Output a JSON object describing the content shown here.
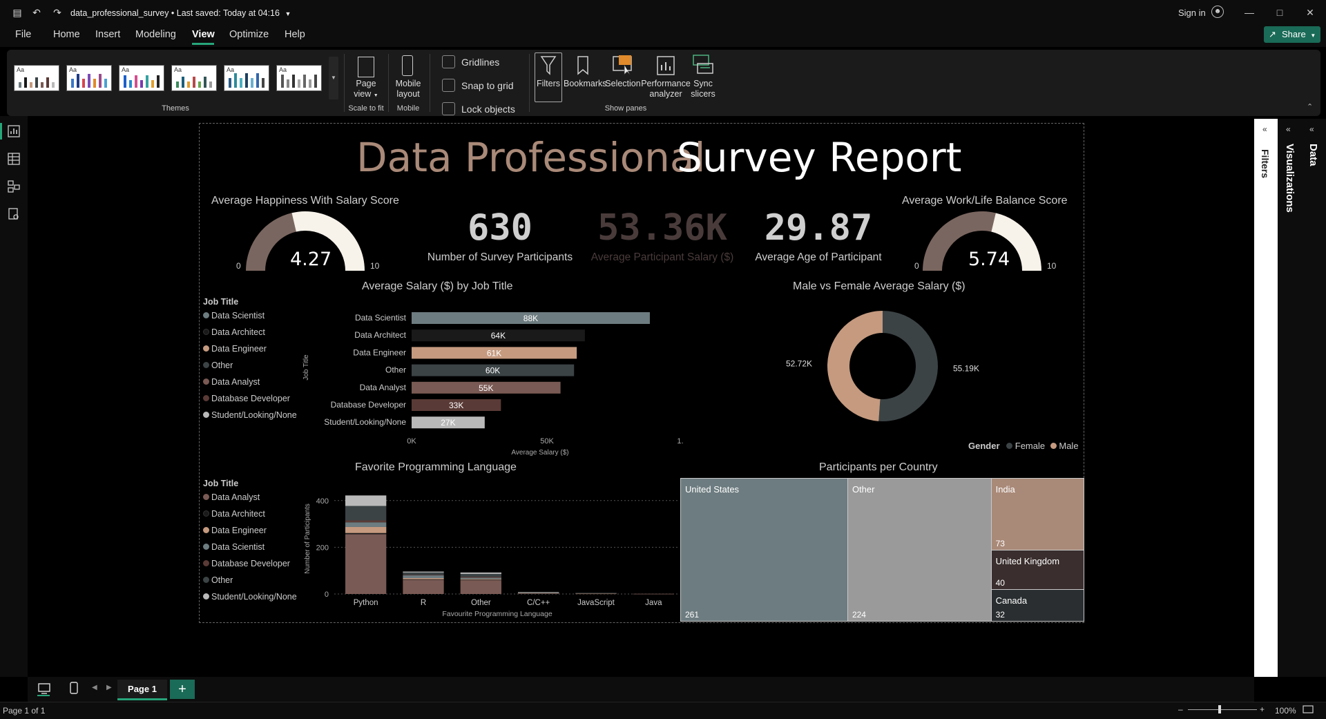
{
  "titlebar": {
    "doc_title": "data_professional_survey",
    "saved_status": " • Last saved: Today at 04:16",
    "sign_in": "Sign in"
  },
  "menu": {
    "items": [
      "File",
      "Home",
      "Insert",
      "Modeling",
      "View",
      "Optimize",
      "Help"
    ],
    "active": "View",
    "share_label": "Share"
  },
  "ribbon": {
    "themes_label": "Themes",
    "page_view_label": "Page view",
    "scale_group": "Scale to fit",
    "mobile_layout_label": "Mobile layout",
    "mobile_group": "Mobile",
    "checkboxes": [
      {
        "label": "Gridlines",
        "checked": false
      },
      {
        "label": "Snap to grid",
        "checked": false
      },
      {
        "label": "Lock objects",
        "checked": false
      }
    ],
    "panes": [
      "Filters",
      "Bookmarks",
      "Selection",
      "Performance analyzer",
      "Sync slicers"
    ],
    "show_panes_label": "Show panes",
    "theme_aa": "Aa"
  },
  "side_panes": {
    "filters": "Filters",
    "visualizations": "Visualizations",
    "data": "Data"
  },
  "report": {
    "title_part1": "Data Professional",
    "title_part2": "Survey Report",
    "gauge_happiness": {
      "title": "Average Happiness With Salary Score",
      "value": 4.27,
      "value_label": "4.27",
      "min": "0",
      "max": "10"
    },
    "gauge_worklife": {
      "title": "Average Work/Life Balance Score",
      "value": 5.74,
      "value_label": "5.74",
      "min": "0",
      "max": "10"
    },
    "kpis": [
      {
        "value": "630",
        "label": "Number of Survey Participants",
        "color": "#cfcfcf"
      },
      {
        "value": "53.36K",
        "label": "Average Participant Salary ($)",
        "color": "#4a3b3b"
      },
      {
        "value": "29.87",
        "label": "Average Age of Participant",
        "color": "#cfcfcf"
      }
    ]
  },
  "colors": {
    "gray": "#6d7c80",
    "black": "#1a1a1a",
    "tan": "#c59a7f",
    "slate": "#3b4345",
    "mauve": "#7a5a54",
    "brown": "#5a3a36",
    "lightgray": "#b9b9b9",
    "cream": "#f7f2ea"
  },
  "chart_data": [
    {
      "type": "bar",
      "title": "Average Salary ($) by Job Title",
      "legend_title": "Job Title",
      "ylabel": "Job Title",
      "xlabel": "Average Salary ($)",
      "x_ticks": [
        "0K",
        "50K",
        "1..."
      ],
      "xlim": [
        0,
        100
      ],
      "categories": [
        "Data Scientist",
        "Data Architect",
        "Data Engineer",
        "Other",
        "Data Analyst",
        "Database Developer",
        "Student/Looking/None"
      ],
      "values": [
        88,
        64,
        61,
        60,
        55,
        33,
        27
      ],
      "data_labels": [
        "88K",
        "64K",
        "61K",
        "60K",
        "55K",
        "33K",
        "27K"
      ],
      "colors": [
        "#6d7c80",
        "#1a1a1a",
        "#c59a7f",
        "#3b4345",
        "#7a5a54",
        "#5a3a36",
        "#b9b9b9"
      ]
    },
    {
      "type": "pie",
      "title": "Male vs Female Average Salary ($)",
      "legend_title": "Gender",
      "slices": [
        {
          "name": "Female",
          "value": 55.19,
          "label": "55.19K",
          "color": "#3b4345"
        },
        {
          "name": "Male",
          "value": 52.72,
          "label": "52.72K",
          "color": "#c59a7f"
        }
      ]
    },
    {
      "type": "bar",
      "stacked": true,
      "title": "Favorite Programming Language",
      "legend_title": "Job Title",
      "xlabel": "Favourite Programming Language",
      "ylabel": "Number of Participants",
      "ylim": [
        0,
        420
      ],
      "y_ticks": [
        "0",
        "200",
        "400"
      ],
      "categories": [
        "Python",
        "R",
        "Other",
        "C/C++",
        "JavaScript",
        "Java"
      ],
      "series": [
        {
          "name": "Data Analyst",
          "color": "#7a5a54",
          "values": [
            256,
            62,
            60,
            3,
            2,
            1
          ]
        },
        {
          "name": "Data Architect",
          "color": "#1a1a1a",
          "values": [
            5,
            1,
            1,
            1,
            1,
            0
          ]
        },
        {
          "name": "Data Engineer",
          "color": "#c59a7f",
          "values": [
            26,
            5,
            3,
            1,
            1,
            0
          ]
        },
        {
          "name": "Data Scientist",
          "color": "#6d7c80",
          "values": [
            20,
            12,
            6,
            1,
            0,
            0
          ]
        },
        {
          "name": "Database Developer",
          "color": "#5a3a36",
          "values": [
            8,
            2,
            4,
            0,
            0,
            0
          ]
        },
        {
          "name": "Other",
          "color": "#3b4345",
          "values": [
            62,
            10,
            12,
            1,
            1,
            0
          ]
        },
        {
          "name": "Student/Looking/None",
          "color": "#b9b9b9",
          "values": [
            45,
            4,
            6,
            1,
            0,
            0
          ]
        }
      ]
    },
    {
      "type": "treemap",
      "title": "Participants per Country",
      "items": [
        {
          "name": "United States",
          "value": 261,
          "label": "261",
          "color": "#6d7c80"
        },
        {
          "name": "Other",
          "value": 224,
          "label": "224",
          "color": "#9a9a9a"
        },
        {
          "name": "India",
          "value": 73,
          "label": "73",
          "color": "#a98978"
        },
        {
          "name": "United Kingdom",
          "value": 40,
          "label": "40",
          "color": "#3a2e2e"
        },
        {
          "name": "Canada",
          "value": 32,
          "label": "32",
          "color": "#2a2e30"
        }
      ]
    }
  ],
  "footer": {
    "page_tab": "Page 1",
    "page_of": "Page 1 of 1",
    "zoom": "100%"
  }
}
